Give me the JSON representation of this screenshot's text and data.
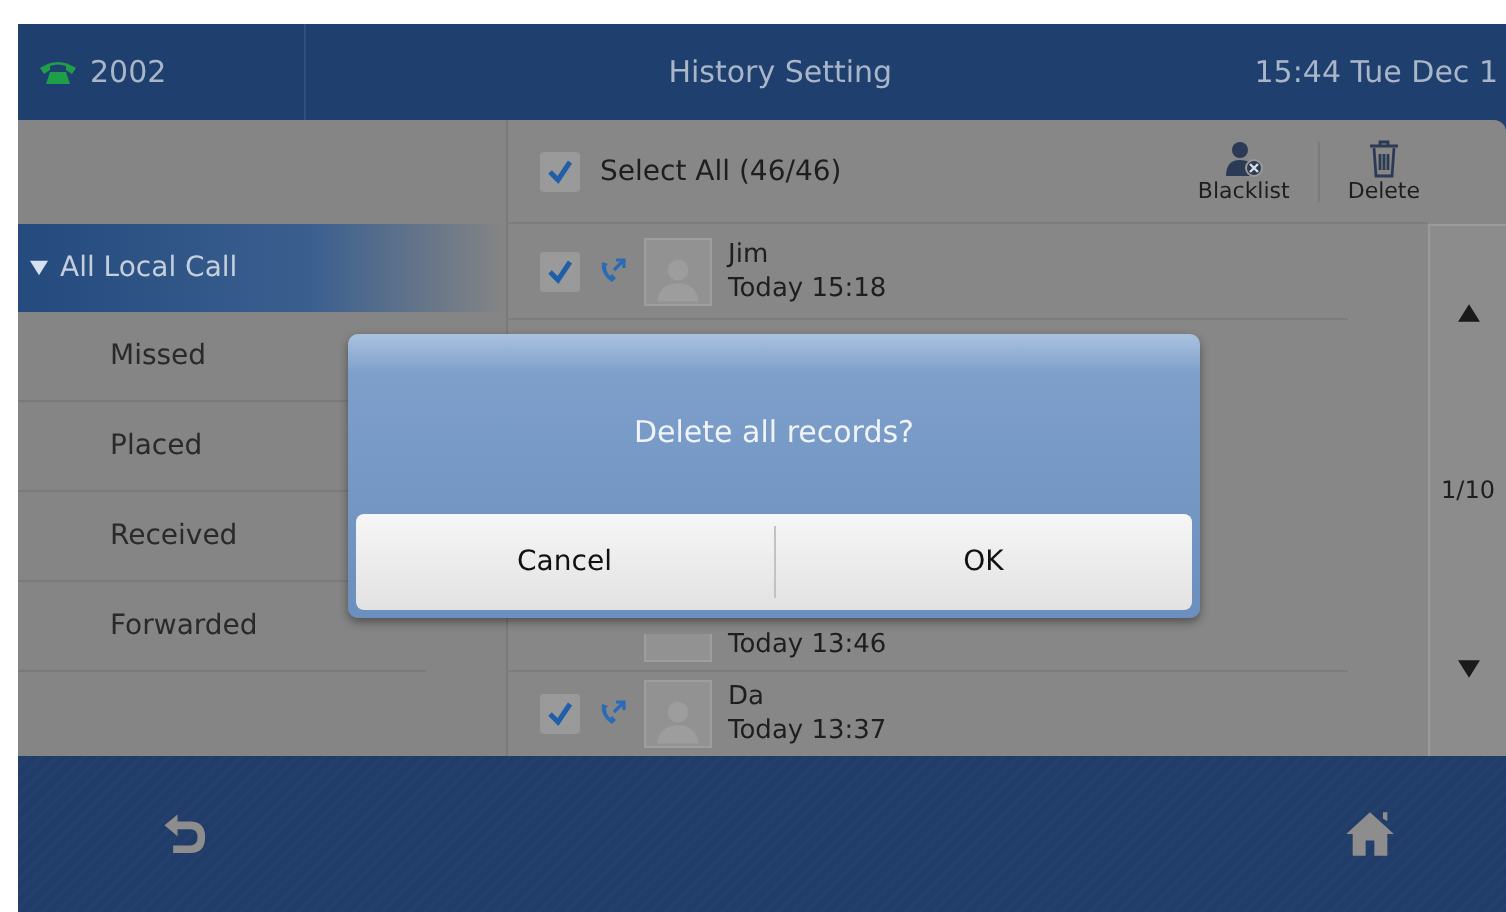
{
  "status_bar": {
    "line": "2002",
    "title": "History Setting",
    "clock": "15:44 Tue Dec 1"
  },
  "sidebar": {
    "items": [
      {
        "label": "All Local Call",
        "expanded": true,
        "selected": true,
        "children": [
          {
            "label": "Missed",
            "selected": false
          },
          {
            "label": "Placed",
            "selected": false
          },
          {
            "label": "Received",
            "selected": false
          },
          {
            "label": "Forwarded",
            "selected": false
          }
        ]
      }
    ]
  },
  "toolbar": {
    "select_all": {
      "label": "Select All (46/46)",
      "checked": true
    },
    "buttons": [
      {
        "kind": "blacklist",
        "label": "Blacklist"
      },
      {
        "kind": "delete",
        "label": "Delete"
      }
    ]
  },
  "records": [
    {
      "kind": "full",
      "name": "Jim",
      "time": "Today 15:18",
      "checked": true
    },
    {
      "kind": "partial",
      "time": "Today 13:46"
    },
    {
      "kind": "full",
      "name": "Da",
      "time": "Today 13:37",
      "checked": true
    }
  ],
  "pager": {
    "page": "1/10"
  },
  "dialog": {
    "message": "Delete all records?",
    "buttons": [
      "Cancel",
      "OK"
    ]
  }
}
